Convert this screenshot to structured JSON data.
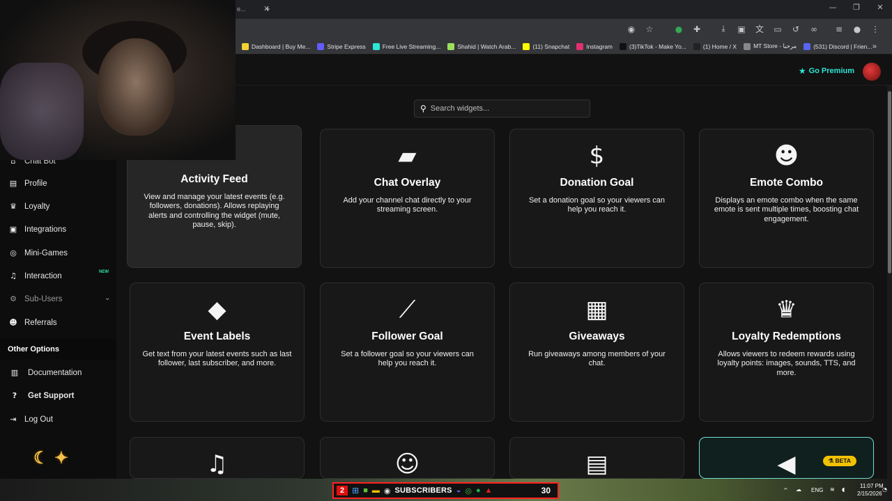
{
  "browser": {
    "tab_fragment": "e...",
    "new_tab": "+",
    "window_controls": [
      "—",
      "❐",
      "✕"
    ],
    "bookmarks": [
      {
        "label": "Dashboard | Buy Me...",
        "color": "#f5d033"
      },
      {
        "label": "Stripe Express",
        "color": "#635bff"
      },
      {
        "label": "Free Live Streaming...",
        "color": "#2ee6d6"
      },
      {
        "label": "Shahid | Watch Arab...",
        "color": "#9be15d"
      },
      {
        "label": "(11) Snapchat",
        "color": "#fffc00"
      },
      {
        "label": "Instagram",
        "color": "#e1306c"
      },
      {
        "label": "(3)TikTok - Make Yo...",
        "color": "#111111"
      },
      {
        "label": "(1) Home / X",
        "color": "#222222"
      },
      {
        "label": "MT Store - مرحبا",
        "color": "#888888"
      },
      {
        "label": "(531) Discord | Frien...",
        "color": "#5865f2"
      }
    ]
  },
  "header": {
    "premium_label": "Go Premium"
  },
  "search": {
    "placeholder": "Search widgets..."
  },
  "sidebar": {
    "items": [
      {
        "label": "Chat Bot",
        "icon": "robot-icon"
      },
      {
        "label": "Profile",
        "icon": "id-card-icon"
      },
      {
        "label": "Loyalty",
        "icon": "trophy-icon"
      },
      {
        "label": "Integrations",
        "icon": "plug-icon"
      },
      {
        "label": "Mini-Games",
        "icon": "gamepad-icon"
      },
      {
        "label": "Interaction",
        "icon": "music-icon",
        "badge": "NEW"
      },
      {
        "label": "Sub-Users",
        "icon": "users-cog-icon"
      },
      {
        "label": "Referrals",
        "icon": "users-icon"
      }
    ],
    "other_options_title": "Other Options",
    "other_items": [
      {
        "label": "Documentation",
        "icon": "book-icon"
      },
      {
        "label": "Get Support",
        "icon": "question-icon"
      },
      {
        "label": "Log Out",
        "icon": "logout-icon"
      }
    ]
  },
  "widgets": [
    {
      "title": "Activity Feed",
      "desc": "View and manage your latest events (e.g. followers, donations). Allows replaying alerts and controlling the widget (mute, pause, skip).",
      "icon": "list-icon"
    },
    {
      "title": "Chat Overlay",
      "desc": "Add your channel chat directly to your streaming screen.",
      "icon": "comment-icon"
    },
    {
      "title": "Donation Goal",
      "desc": "Set a donation goal so your viewers can help you reach it.",
      "icon": "dollar-icon"
    },
    {
      "title": "Emote Combo",
      "desc": "Displays an emote combo when the same emote is sent multiple times, boosting chat engagement.",
      "icon": "emote-icon"
    },
    {
      "title": "Event Labels",
      "desc": "Get text from your latest events such as last follower, last subscriber, and more.",
      "icon": "tags-icon"
    },
    {
      "title": "Follower Goal",
      "desc": "Set a follower goal so your viewers can help you reach it.",
      "icon": "chart-line-icon"
    },
    {
      "title": "Giveaways",
      "desc": "Run giveaways among members of your chat.",
      "icon": "gifts-icon"
    },
    {
      "title": "Loyalty Redemptions",
      "desc": "Allows viewers to redeem rewards using loyalty points: images, sounds, TTS, and more.",
      "icon": "trophy-icon"
    },
    {
      "title": "",
      "desc": "",
      "icon": "music-icon"
    },
    {
      "title": "",
      "desc": "",
      "icon": "tongue-emoji-icon"
    },
    {
      "title": "",
      "desc": "",
      "icon": "document-icon"
    },
    {
      "title": "",
      "desc": "",
      "icon": "megaphone-icon",
      "badge": "BETA"
    }
  ],
  "taskbar": {
    "badge_number": "2",
    "subscribers_label": "SUBSCRIBERS",
    "subscribers_count": "30",
    "language": "ENG",
    "time": "11:07 PM",
    "date": "2/15/2026"
  },
  "colors": {
    "accent": "#2ee6d6",
    "beta_badge": "#f2c200",
    "new_badge": "#2ee6a0"
  }
}
